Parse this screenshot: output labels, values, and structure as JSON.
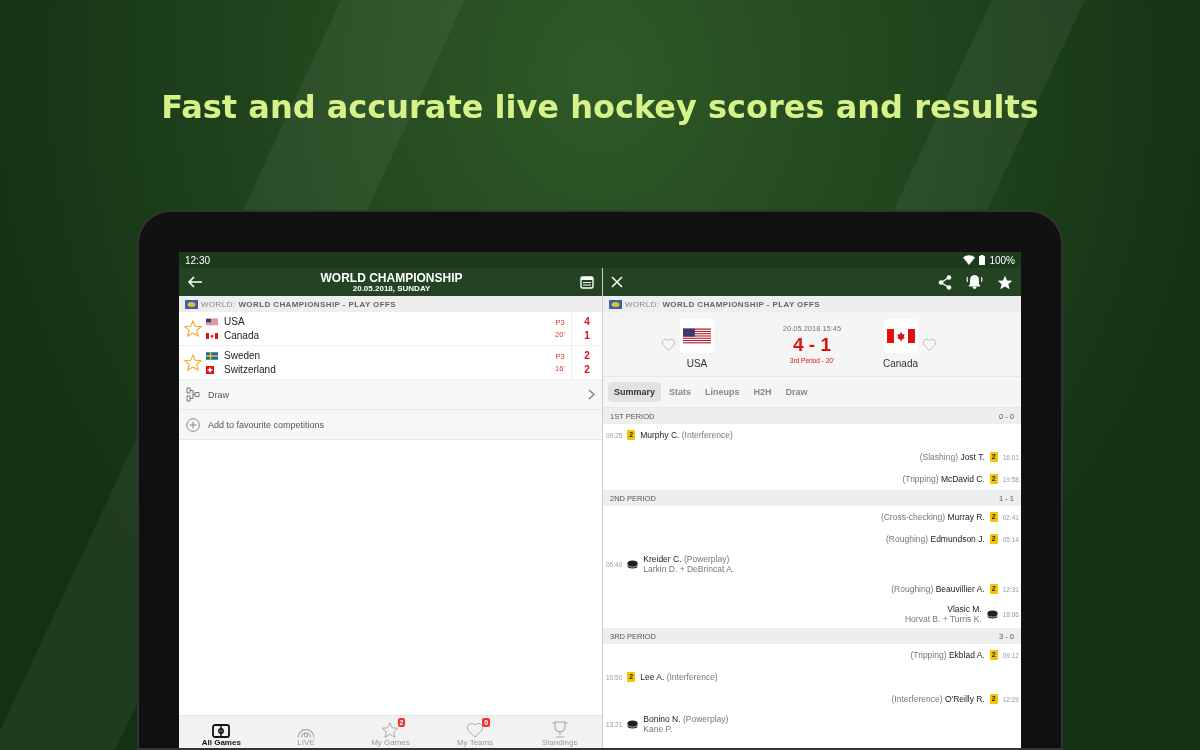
{
  "headline": "Fast and accurate live hockey scores and results",
  "status_bar": {
    "time": "12:30",
    "battery": "100%"
  },
  "left_pane": {
    "title": "WORLD CHAMPIONSHIP",
    "subtitle": "20.05.2018, SUNDAY",
    "competition": {
      "prefix": "WORLD:",
      "name": "WORLD CHAMPIONSHIP - PLAY OFFS"
    },
    "matches": [
      {
        "favourite": false,
        "period": "P3",
        "minute": "20'",
        "teams": [
          {
            "name": "USA",
            "kind": "usa",
            "score": "4"
          },
          {
            "name": "Canada",
            "kind": "can",
            "score": "1"
          }
        ]
      },
      {
        "favourite": false,
        "period": "P3",
        "minute": "16'",
        "teams": [
          {
            "name": "Sweden",
            "kind": "swe",
            "score": "2"
          },
          {
            "name": "Switzerland",
            "kind": "sui",
            "score": "2"
          }
        ]
      }
    ],
    "draw_row": "Draw",
    "add_favourite": "Add to favourite competitions",
    "bottom_nav": [
      {
        "label": "All Games",
        "kind": "pitch",
        "selected": true
      },
      {
        "label": "LIVE",
        "kind": "live",
        "selected": false
      },
      {
        "label": "My Games",
        "kind": "star",
        "selected": false,
        "badge": "2"
      },
      {
        "label": "My Teams",
        "kind": "heart",
        "selected": false,
        "badge": "0"
      },
      {
        "label": "Standings",
        "kind": "trophy",
        "selected": false
      }
    ]
  },
  "detail": {
    "competition": {
      "prefix": "WORLD:",
      "name": "WORLD CHAMPIONSHIP - PLAY OFFS"
    },
    "datetime": "20.05.2018 15:45",
    "score": "4 - 1",
    "status": "3rd Period - 20'",
    "home": {
      "name": "USA",
      "kind": "usa",
      "favourite": false
    },
    "away": {
      "name": "Canada",
      "kind": "can",
      "favourite": false
    },
    "tabs": [
      {
        "label": "Summary",
        "selected": true
      },
      {
        "label": "Stats",
        "selected": false
      },
      {
        "label": "Lineups",
        "selected": false
      },
      {
        "label": "H2H",
        "selected": false
      },
      {
        "label": "Draw",
        "selected": false
      }
    ],
    "periods": [
      {
        "name": "1ST PERIOD",
        "score": "0 - 0",
        "events": [
          {
            "kind": "home_penalty",
            "time": "09:25",
            "minutes": "2",
            "player": "Murphy C.",
            "detail": "(Interference)"
          },
          {
            "kind": "away_penalty",
            "time": "16:01",
            "minutes": "2",
            "player": "Jost T.",
            "detail": "(Slashing)"
          },
          {
            "kind": "away_penalty",
            "time": "19:58",
            "minutes": "2",
            "player": "McDavid C.",
            "detail": "(Tripping)"
          }
        ]
      },
      {
        "name": "2ND PERIOD",
        "score": "1 - 1",
        "events": [
          {
            "kind": "away_penalty",
            "time": "02:41",
            "minutes": "2",
            "player": "Murray R.",
            "detail": "(Cross-checking)"
          },
          {
            "kind": "away_penalty",
            "time": "05:14",
            "minutes": "2",
            "player": "Edmundson J.",
            "detail": "(Roughing)"
          },
          {
            "kind": "home_goal",
            "time": "06:40",
            "player": "Kreider C.",
            "detail": "(Powerplay)",
            "assist": "Larkin D. + DeBrincat A."
          },
          {
            "kind": "away_penalty",
            "time": "12:31",
            "minutes": "2",
            "player": "Beauvillier A.",
            "detail": "(Roughing)"
          },
          {
            "kind": "away_goal",
            "time": "18:06",
            "player": "Vlasic M.",
            "assist": "Horvat B. + Turris K."
          }
        ]
      },
      {
        "name": "3RD PERIOD",
        "score": "3 - 0",
        "events": [
          {
            "kind": "away_penalty",
            "time": "09:12",
            "minutes": "2",
            "player": "Ekblad A.",
            "detail": "(Tripping)"
          },
          {
            "kind": "home_penalty",
            "time": "10:50",
            "minutes": "2",
            "player": "Lee A.",
            "detail": "(Interference)"
          },
          {
            "kind": "away_penalty",
            "time": "12:29",
            "minutes": "2",
            "player": "O'Reilly R.",
            "detail": "(Interference)"
          },
          {
            "kind": "home_goal",
            "time": "13:21",
            "player": "Bonino N.",
            "detail": "(Powerplay)",
            "assist": "Kane P."
          }
        ]
      }
    ]
  }
}
